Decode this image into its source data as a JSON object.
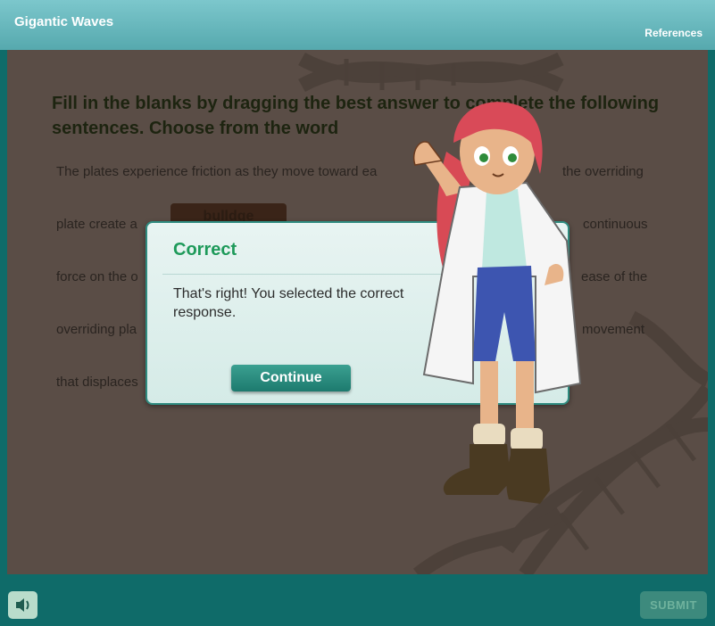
{
  "header": {
    "title": "Gigantic Waves",
    "references_label": "References"
  },
  "question": {
    "prompt": "Fill in the blanks by dragging the best answer to complete the following sentences. Choose from the word",
    "lines": [
      "The plates experience friction as they move toward ea",
      "the overriding",
      "plate create a",
      "continuous",
      "force on the o",
      "ease of the",
      "overriding pla",
      "movement",
      "that displaces"
    ],
    "blank_answer": "bulldge"
  },
  "dialog": {
    "title": "Correct",
    "message": "That's right!  You selected the correct response.",
    "continue_label": "Continue"
  },
  "footer": {
    "submit_label": "SUBMIT",
    "sound_icon": "speaker-icon"
  },
  "colors": {
    "header_bg": "#6cbabf",
    "footer_bg": "#0f6b69",
    "dialog_title": "#1e9a5a",
    "continue_bg": "#237f72"
  }
}
